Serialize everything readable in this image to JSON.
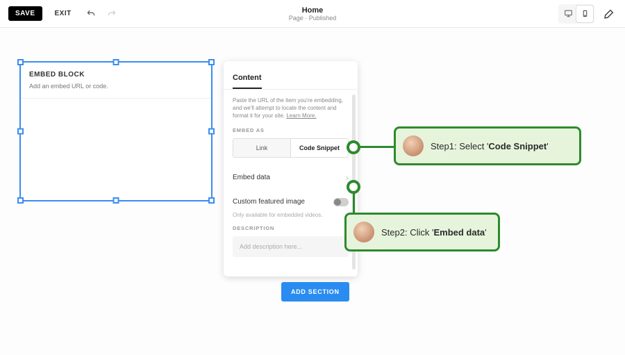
{
  "toolbar": {
    "save": "SAVE",
    "exit": "EXIT",
    "title": "Home",
    "subtitle": "Page · Published"
  },
  "embed_block": {
    "title": "EMBED BLOCK",
    "hint": "Add an embed URL or code."
  },
  "panel": {
    "title": "Content",
    "intro_a": "Paste the URL of the item you're embedding, and we'll attempt to locate the content and format it for your site. ",
    "intro_link": "Learn More.",
    "embed_as_label": "EMBED AS",
    "seg_link": "Link",
    "seg_code": "Code Snippet",
    "embed_data": "Embed data",
    "featured": "Custom featured image",
    "featured_sub": "Only available for embedded videos.",
    "description_label": "DESCRIPTION",
    "description_placeholder": "Add description here..."
  },
  "add_section": "ADD SECTION",
  "callouts": {
    "step1_prefix": "Step1: Select '",
    "step1_bold": "Code Snippet",
    "step1_suffix": "'",
    "step2_prefix": "Step2: Click '",
    "step2_bold": "Embed data",
    "step2_suffix": "'"
  }
}
